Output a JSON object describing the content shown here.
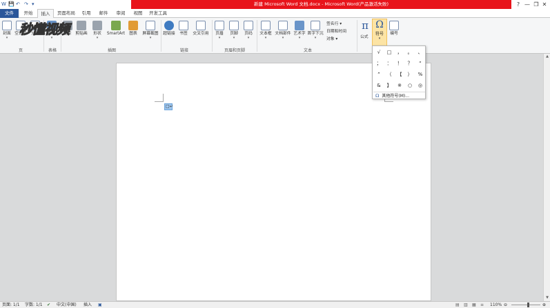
{
  "window": {
    "title": "新建 Microsoft Word 文档.docx - Microsoft Word(产品激活失败)",
    "controls": [
      "?",
      "—",
      "❐",
      "✕"
    ]
  },
  "quick_access": [
    "W",
    "💾",
    "↶",
    "↷",
    "▾"
  ],
  "tabs": [
    {
      "label": "文件"
    },
    {
      "label": "开始"
    },
    {
      "label": "插入"
    },
    {
      "label": "页面布局"
    },
    {
      "label": "引用"
    },
    {
      "label": "邮件"
    },
    {
      "label": "审阅"
    },
    {
      "label": "视图"
    },
    {
      "label": "开发工具"
    }
  ],
  "ribbon": {
    "pages": [
      "封面",
      "空白页",
      "分页"
    ],
    "tables": [
      "表格"
    ],
    "illustrations": [
      "图片",
      "剪贴画",
      "形状",
      "SmartArt",
      "图表",
      "屏幕截图"
    ],
    "links": [
      "超链接",
      "书签",
      "交叉引用"
    ],
    "header_footer": [
      "页眉",
      "页脚",
      "页码"
    ],
    "text": [
      "文本框",
      "文档部件",
      "艺术字",
      "首字下沉"
    ],
    "text_small": [
      "签名行 ▾",
      "日期和时间",
      "对象 ▾"
    ],
    "equation": "公式",
    "symbol": "符号",
    "number": "编号",
    "groups": [
      "页",
      "表格",
      "插图",
      "链接",
      "页眉和页脚",
      "文本"
    ]
  },
  "watermark": "秒懂视频",
  "symbol_panel": {
    "symbols": [
      "√",
      "□",
      "，",
      "。",
      "、",
      "；",
      "：",
      "！",
      "？",
      "“",
      "”",
      "（",
      "【",
      "）",
      "%",
      "&",
      "】",
      "※",
      "○",
      "◎"
    ],
    "more_label": "其他符号(M)..."
  },
  "document": {
    "cursor_symbol": "□↵"
  },
  "statusbar": {
    "page": "页面: 1/1",
    "words": "字数: 1/1",
    "language": "中文(中国)",
    "mode": "插入",
    "zoom": "110%"
  }
}
